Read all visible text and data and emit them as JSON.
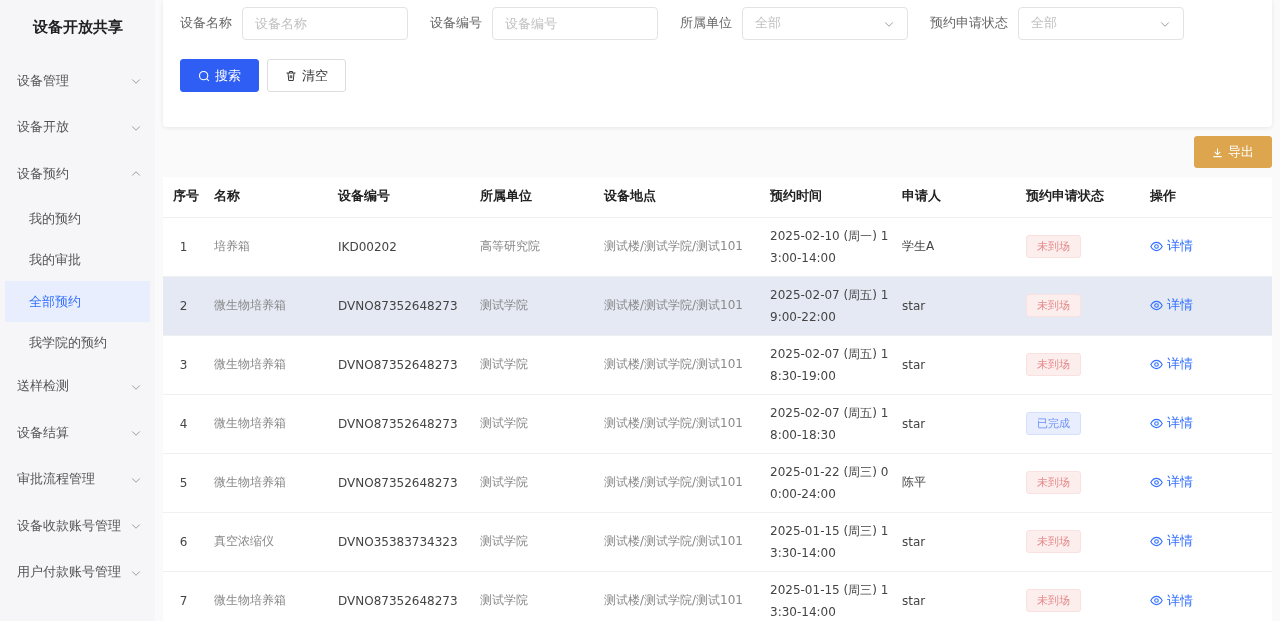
{
  "sidebar": {
    "title": "设备开放共享",
    "items": [
      {
        "label": "设备管理",
        "expanded": false
      },
      {
        "label": "设备开放",
        "expanded": false
      },
      {
        "label": "设备预约",
        "expanded": true,
        "children": [
          {
            "label": "我的预约",
            "selected": false
          },
          {
            "label": "我的审批",
            "selected": false
          },
          {
            "label": "全部预约",
            "selected": true
          },
          {
            "label": "我学院的预约",
            "selected": false
          }
        ]
      },
      {
        "label": "送样检测",
        "expanded": false
      },
      {
        "label": "设备结算",
        "expanded": false
      },
      {
        "label": "审批流程管理",
        "expanded": false
      },
      {
        "label": "设备收款账号管理",
        "expanded": false
      },
      {
        "label": "用户付款账号管理",
        "expanded": false
      }
    ]
  },
  "filters": [
    {
      "kind": "input",
      "label": "设备名称",
      "placeholder": "设备名称"
    },
    {
      "kind": "input",
      "label": "设备编号",
      "placeholder": "设备编号"
    },
    {
      "kind": "select",
      "label": "所属单位",
      "placeholder": "全部"
    },
    {
      "kind": "select",
      "label": "预约申请状态",
      "placeholder": "全部"
    }
  ],
  "buttons": {
    "search": "搜索",
    "clear": "清空",
    "export": "导出"
  },
  "table": {
    "columns": [
      "序号",
      "名称",
      "设备编号",
      "所属单位",
      "设备地点",
      "预约时间",
      "申请人",
      "预约申请状态",
      "操作"
    ],
    "rows": [
      {
        "selected": false,
        "no": "1",
        "name": "培养箱",
        "code": "IKD00202",
        "unit": "高等研究院",
        "location": "测试楼/测试学院/测试101",
        "time": [
          "2025-02-10 (周一) 1",
          "3:00-14:00"
        ],
        "applicant": "学生A",
        "status": {
          "kind": "absent",
          "label": "未到场"
        },
        "action": "详情"
      },
      {
        "selected": true,
        "no": "2",
        "name": "微生物培养箱",
        "code": "DVNO87352648273",
        "unit": "测试学院",
        "location": "测试楼/测试学院/测试101",
        "time": [
          "2025-02-07 (周五) 1",
          "9:00-22:00"
        ],
        "applicant": "star",
        "status": {
          "kind": "absent",
          "label": "未到场"
        },
        "action": "详情"
      },
      {
        "selected": false,
        "no": "3",
        "name": "微生物培养箱",
        "code": "DVNO87352648273",
        "unit": "测试学院",
        "location": "测试楼/测试学院/测试101",
        "time": [
          "2025-02-07 (周五) 1",
          "8:30-19:00"
        ],
        "applicant": "star",
        "status": {
          "kind": "absent",
          "label": "未到场"
        },
        "action": "详情"
      },
      {
        "selected": false,
        "no": "4",
        "name": "微生物培养箱",
        "code": "DVNO87352648273",
        "unit": "测试学院",
        "location": "测试楼/测试学院/测试101",
        "time": [
          "2025-02-07 (周五) 1",
          "8:00-18:30"
        ],
        "applicant": "star",
        "status": {
          "kind": "done",
          "label": "已完成"
        },
        "action": "详情"
      },
      {
        "selected": false,
        "no": "5",
        "name": "微生物培养箱",
        "code": "DVNO87352648273",
        "unit": "测试学院",
        "location": "测试楼/测试学院/测试101",
        "time": [
          "2025-01-22 (周三) 0",
          "0:00-24:00"
        ],
        "applicant": "陈平",
        "status": {
          "kind": "absent",
          "label": "未到场"
        },
        "action": "详情"
      },
      {
        "selected": false,
        "no": "6",
        "name": "真空浓缩仪",
        "code": "DVNO35383734323",
        "unit": "测试学院",
        "location": "测试楼/测试学院/测试101",
        "time": [
          "2025-01-15 (周三) 1",
          "3:30-14:00"
        ],
        "applicant": "star",
        "status": {
          "kind": "absent",
          "label": "未到场"
        },
        "action": "详情"
      },
      {
        "selected": false,
        "no": "7",
        "name": "微生物培养箱",
        "code": "DVNO87352648273",
        "unit": "测试学院",
        "location": "测试楼/测试学院/测试101",
        "time": [
          "2025-01-15 (周三) 1",
          "3:30-14:00"
        ],
        "applicant": "star",
        "status": {
          "kind": "absent",
          "label": "未到场"
        },
        "action": "详情"
      }
    ]
  }
}
